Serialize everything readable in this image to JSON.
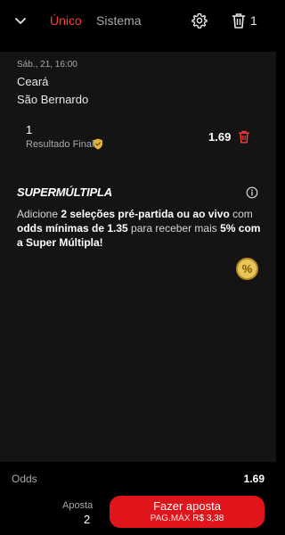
{
  "header": {
    "tabs": [
      {
        "label": "Único",
        "active": true
      },
      {
        "label": "Sistema",
        "active": false
      }
    ],
    "slip_count": "1",
    "icons": {
      "collapse": "chevron-down-icon",
      "settings": "gear-icon",
      "clear": "trash-icon"
    }
  },
  "event": {
    "datetime": "Sáb., 21, 16:00",
    "home": "Ceará",
    "away": "São Bernardo"
  },
  "selection": {
    "pick": "1",
    "market": "Resultado Final",
    "odd": "1.69",
    "market_icon": "shield-icon",
    "remove_icon": "trash-icon"
  },
  "promo": {
    "title": "SUPERMÚLTIPLA",
    "text_1": "Adicione ",
    "bold_1": "2 seleções pré-partida ou ao vivo",
    "text_2": " com ",
    "bold_2": "odds mínimas de 1.35",
    "text_3": " para receber mais ",
    "bold_3": "5% com a Super Múltipla!",
    "badge_symbol": "%",
    "info_icon": "info-icon"
  },
  "footer": {
    "odds_label": "Odds",
    "odds_value": "1.69",
    "stake_label": "Aposta",
    "stake_value": "2",
    "button_label": "Fazer aposta",
    "max_label": "PAG.MÁX",
    "max_value": "R$ 3,38"
  },
  "colors": {
    "accent": "#e0141b",
    "active_tab": "#ff3b3b",
    "card_bg": "#141414",
    "badge": "#e9c45a"
  }
}
